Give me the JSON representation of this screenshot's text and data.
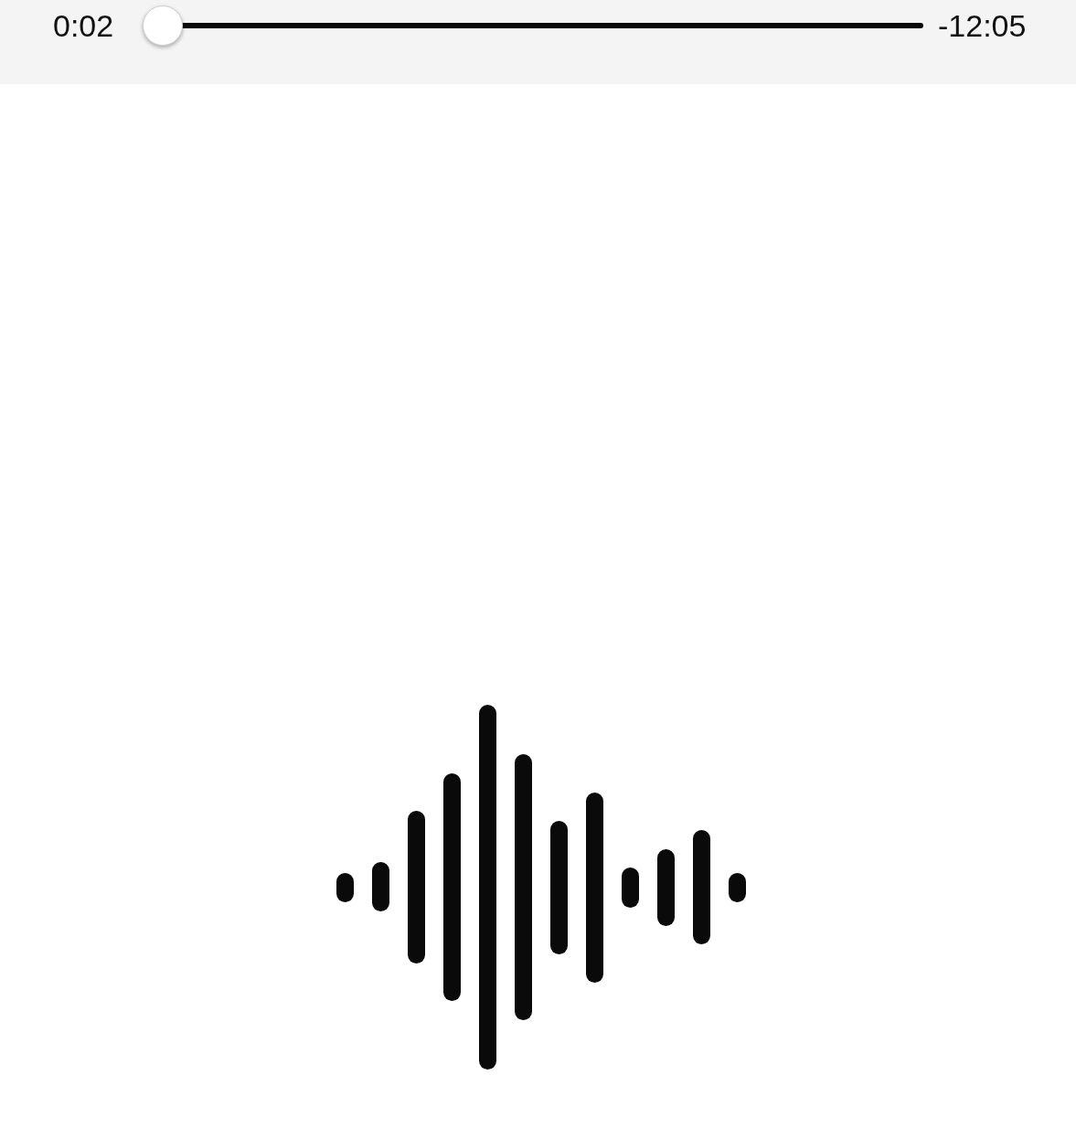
{
  "player": {
    "elapsed": "0:02",
    "remaining": "-12:05",
    "level": 0.003
  }
}
